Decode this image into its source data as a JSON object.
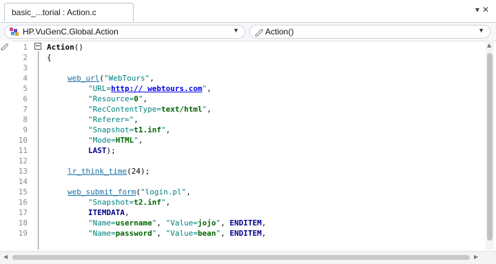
{
  "tab": {
    "label": "basic_...torial : Action.c",
    "menu": "▾",
    "close": "✕"
  },
  "nav": {
    "left": "HP.VuGenC.Global.Action",
    "right": "Action()"
  },
  "lines": [
    "1",
    "2",
    "3",
    "4",
    "5",
    "6",
    "7",
    "8",
    "9",
    "10",
    "11",
    "12",
    "13",
    "14",
    "15",
    "16",
    "17",
    "18",
    "19"
  ],
  "code": {
    "l1_a": "Action",
    "l1_b": "()",
    "l2": "{",
    "l4_fn": "web_url",
    "l4_b": "(",
    "l4_s": "\"WebTours\"",
    "l4_c": ",",
    "l5_s1": "\"URL=",
    "l5_v": "http:// webtours.com",
    "l5_s2": "\"",
    "l5_c": ",",
    "l6_s1": "\"Resource=",
    "l6_v": "0",
    "l6_s2": "\"",
    "l6_c": ",",
    "l7_s1": "\"RecContentType=",
    "l7_v": "text/html",
    "l7_s2": "\"",
    "l7_c": ",",
    "l8_s1": "\"Referer=\"",
    "l8_c": ",",
    "l9_s1": "\"Snapshot=",
    "l9_v": "t1.inf",
    "l9_s2": "\"",
    "l9_c": ",",
    "l10_s1": "\"Mode=",
    "l10_v": "HTML",
    "l10_s2": "\"",
    "l10_c": ",",
    "l11_k": "LAST",
    "l11_c": ");",
    "l13_fn": "lr_think_time",
    "l13_b": "(24);",
    "l15_fn": "web_submit_form",
    "l15_b": "(",
    "l15_s": "\"login.pl\"",
    "l15_c": ",",
    "l16_s1": "\"Snapshot=",
    "l16_v": "t2.inf",
    "l16_s2": "\"",
    "l16_c": ",",
    "l17_k": "ITEMDATA",
    "l17_c": ",",
    "l18_s1": "\"Name=",
    "l18_v1": "username",
    "l18_s2": "\"",
    "l18_c1": ", ",
    "l18_s3": "\"Value=",
    "l18_v2": "jojo",
    "l18_s4": "\"",
    "l18_c2": ", ",
    "l18_k": "ENDITEM",
    "l18_c3": ",",
    "l19_s1": "\"Name=",
    "l19_v1": "password",
    "l19_s2": "\"",
    "l19_c1": ", ",
    "l19_s3": "\"Value=",
    "l19_v2": "bean",
    "l19_s4": "\"",
    "l19_c2": ", ",
    "l19_k": "ENDITEM",
    "l19_c3": ","
  }
}
